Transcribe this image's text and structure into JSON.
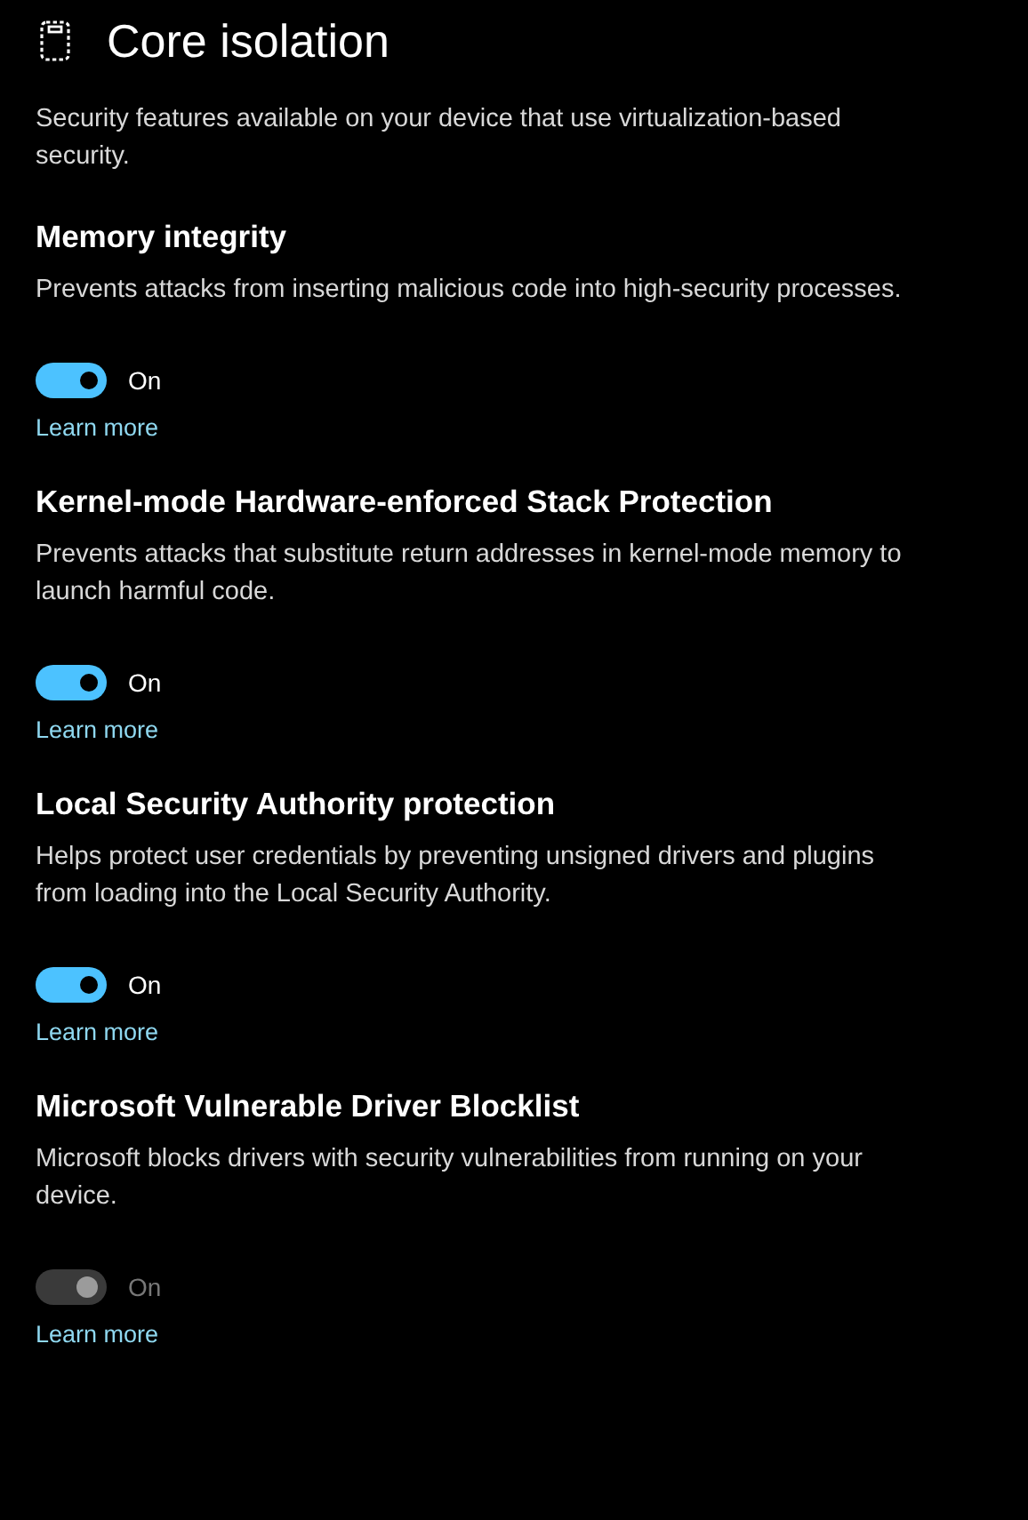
{
  "page": {
    "title": "Core isolation",
    "description": "Security features available on your device that use virtualization-based security."
  },
  "sections": [
    {
      "title": "Memory integrity",
      "description": "Prevents attacks from inserting malicious code into high-security processes.",
      "toggle": {
        "on": true,
        "disabled": false,
        "label": "On"
      },
      "link": "Learn more"
    },
    {
      "title": "Kernel-mode Hardware-enforced Stack Protection",
      "description": "Prevents attacks that substitute return addresses in kernel-mode memory to launch harmful code.",
      "toggle": {
        "on": true,
        "disabled": false,
        "label": "On"
      },
      "link": "Learn more"
    },
    {
      "title": "Local Security Authority protection",
      "description": "Helps protect user credentials by preventing unsigned drivers and plugins from loading into the Local Security Authority.",
      "toggle": {
        "on": true,
        "disabled": false,
        "label": "On"
      },
      "link": "Learn more"
    },
    {
      "title": "Microsoft Vulnerable Driver Blocklist",
      "description": "Microsoft blocks drivers with security vulnerabilities from running on your device.",
      "toggle": {
        "on": true,
        "disabled": true,
        "label": "On"
      },
      "link": "Learn more"
    }
  ]
}
